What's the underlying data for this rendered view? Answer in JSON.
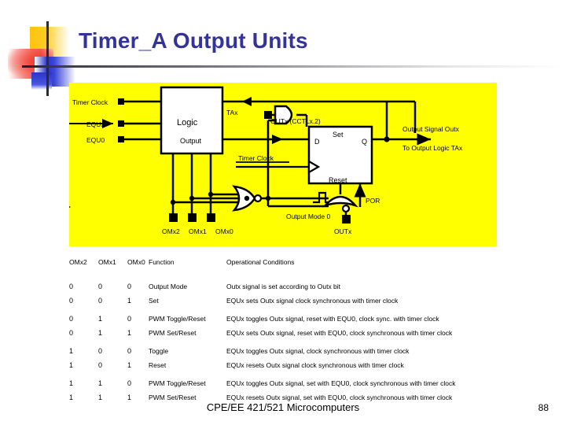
{
  "slide": {
    "title": "Timer_A Output Units",
    "footer_text": "CPE/EE 421/521 Microcomputers",
    "page_number": "88"
  },
  "colors": {
    "title": "#333399",
    "panel_background": "#ffff00",
    "line": "#000000",
    "logo_yellow": "#ffc20e",
    "logo_red": "#ee3124",
    "logo_blue": "#2b35c8",
    "logo_cross": "#2b2b36"
  },
  "diagram": {
    "labels": {
      "timer_clock_in": "Timer Clock",
      "equx": "EQUx",
      "equ0": "EQU0",
      "logic": "Logic",
      "output": "Output",
      "tax": "TAx",
      "outx_cctl": "OUTx (CCTLx.2)",
      "d": "D",
      "set": "Set",
      "q": "Q",
      "reset": "Reset",
      "timer_clock_ff": "Timer Clock",
      "output_signal_outx": "Output Signal Outx",
      "to_output_logic_tax": "To Output Logic TAx",
      "por": "POR",
      "outx_reset": "OUTx",
      "output_mode_0": "Output Mode 0",
      "omx2": "OMx2",
      "omx1": "OMx1",
      "omx0": "OMx0"
    }
  },
  "table": {
    "headers": {
      "om2": "OMx2",
      "om1": "OMx1",
      "om0": "OMx0",
      "function": "Function",
      "conditions": "Operational Conditions"
    },
    "rows": [
      {
        "om2": "0",
        "om1": "0",
        "om0": "0",
        "function": "Output Mode",
        "conditions": "Outx signal is set according to Outx bit"
      },
      {
        "om2": "0",
        "om1": "0",
        "om0": "1",
        "function": "Set",
        "conditions": "EQUx sets Outx signal clock synchronous with timer clock"
      },
      {
        "om2": "0",
        "om1": "1",
        "om0": "0",
        "function": "PWM Toggle/Reset",
        "conditions": "EQUx toggles Outx signal, reset with EQU0, clock sync. with timer clock"
      },
      {
        "om2": "0",
        "om1": "1",
        "om0": "1",
        "function": "PWM Set/Reset",
        "conditions": "EQUx sets Outx signal, reset with EQU0, clock synchronous with timer clock"
      },
      {
        "om2": "1",
        "om1": "0",
        "om0": "0",
        "function": "Toggle",
        "conditions": "EQUx toggles Outx signal, clock synchronous with timer clock"
      },
      {
        "om2": "1",
        "om1": "0",
        "om0": "1",
        "function": "Reset",
        "conditions": "EQUx resets Outx signal clock synchronous with timer clock"
      },
      {
        "om2": "1",
        "om1": "1",
        "om0": "0",
        "function": "PWM Toggle/Reset",
        "conditions": "EQUx toggles Outx signal, set with EQU0, clock synchronous with timer clock"
      },
      {
        "om2": "1",
        "om1": "1",
        "om0": "1",
        "function": "PWM Set/Reset",
        "conditions": "EQUx resets Outx signal, set with EQU0, clock synchronous with timer clock"
      }
    ]
  }
}
